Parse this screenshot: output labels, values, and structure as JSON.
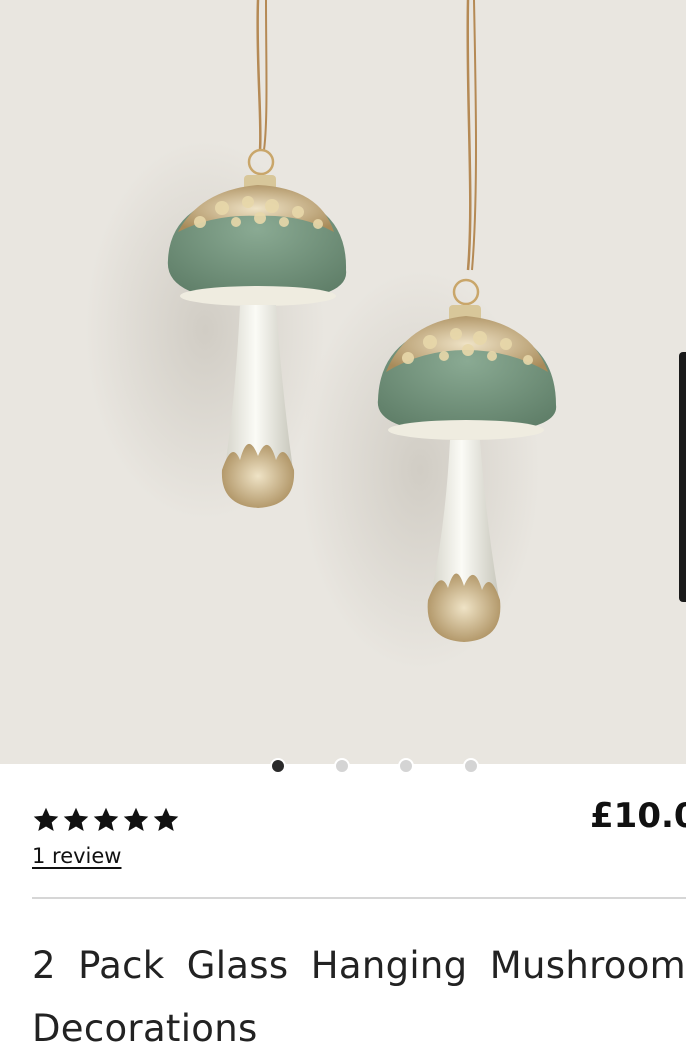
{
  "product": {
    "image_alt": "2 Pack Glass Hanging Mushroom Decorations",
    "carousel": {
      "total_slides": 4,
      "active_slide": 1
    },
    "rating": {
      "stars": 5,
      "max_stars": 5
    },
    "review_link": "1 review",
    "price": "£10.0",
    "title": "2 Pack Glass Hanging Mushroom Decorations"
  },
  "icons": {
    "star": "star-icon",
    "dot": "carousel-dot"
  },
  "colors": {
    "image_background": "#e9e6e0",
    "mushroom_cap": "#7a9a84",
    "glitter": "#c4a875",
    "star": "#111111",
    "dot_active": "#2a2a2a",
    "dot_inactive": "#d4d4d4"
  }
}
